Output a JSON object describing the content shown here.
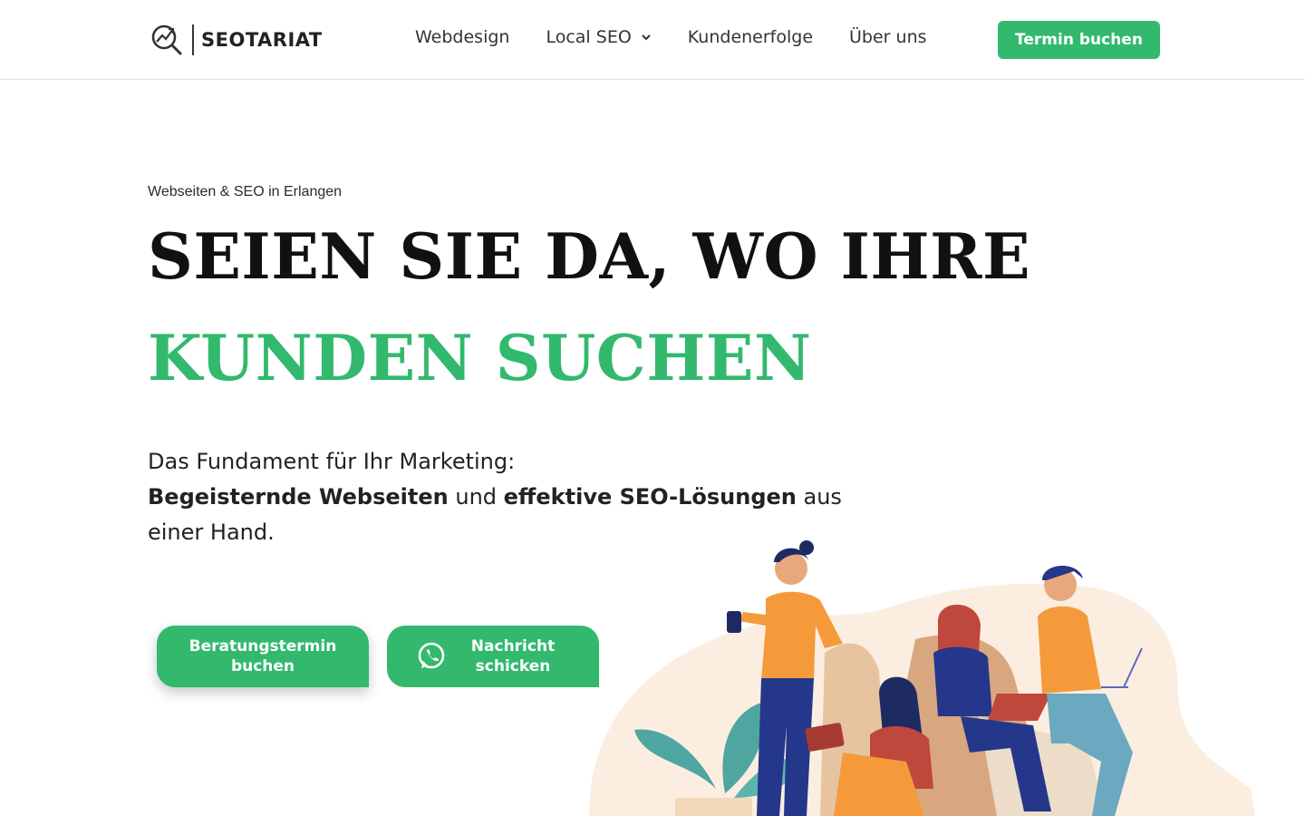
{
  "header": {
    "logo_text": "SEOTARIAT",
    "nav": [
      {
        "label": "Webdesign"
      },
      {
        "label": "Local SEO",
        "has_dropdown": true
      },
      {
        "label": "Kundenerfolge"
      },
      {
        "label": "Über uns"
      }
    ],
    "cta_label": "Termin buchen"
  },
  "hero": {
    "eyebrow": "Webseiten & SEO in Erlangen",
    "headline_line1": "SEIEN SIE DA, WO IHRE",
    "headline_line2": "KUNDEN SUCHEN",
    "lead_line1": "Das Fundament für Ihr Marketing:",
    "lead_bold1": "Begeisternde Webseiten",
    "lead_mid": " und ",
    "lead_bold2": "effektive SEO-Lösungen",
    "lead_end": " aus einer Hand.",
    "btn_consult": "Beratungstermin buchen",
    "btn_message": "Nachricht schicken"
  },
  "colors": {
    "accent": "#32b96e",
    "text": "#1f2328",
    "illustration_bg": "#fbeee0"
  },
  "icons": [
    "logo-magnifier-icon",
    "chevron-down-icon",
    "whatsapp-icon"
  ]
}
